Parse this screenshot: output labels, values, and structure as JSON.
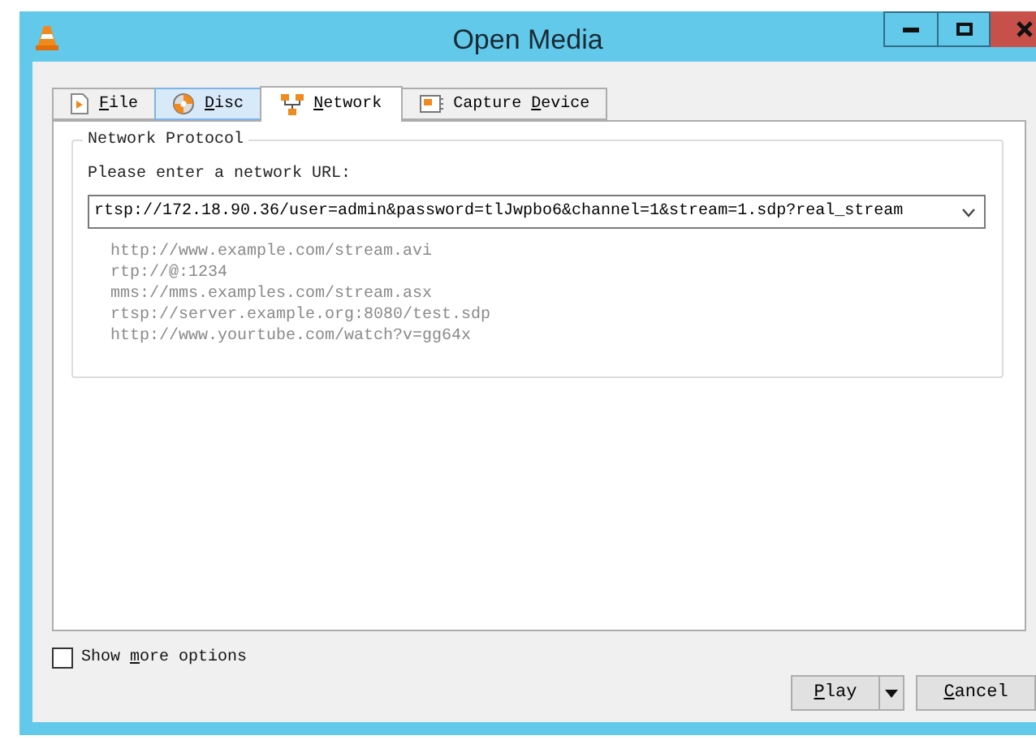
{
  "window": {
    "title": "Open Media"
  },
  "tabs": [
    {
      "kind": "file",
      "mnemonic": "F",
      "after": "ile",
      "selected": false,
      "hovered": false
    },
    {
      "kind": "disc",
      "mnemonic": "D",
      "after": "isc",
      "selected": false,
      "hovered": true
    },
    {
      "kind": "network",
      "mnemonic": "N",
      "after": "etwork",
      "selected": true,
      "hovered": false
    },
    {
      "kind": "capture",
      "before": "Capture ",
      "mnemonic": "D",
      "after": "evice",
      "selected": false,
      "hovered": false
    }
  ],
  "network_protocol": {
    "title": "Network Protocol",
    "prompt": "Please enter a network URL:",
    "url": "rtsp://172.18.90.36/user=admin&password=tlJwpbo6&channel=1&stream=1.sdp?real_stream",
    "examples": [
      "http://www.example.com/stream.avi",
      "rtp://@:1234",
      "mms://mms.examples.com/stream.asx",
      "rtsp://server.example.org:8080/test.sdp",
      "http://www.yourtube.com/watch?v=gg64x"
    ]
  },
  "show_more_options": {
    "before": "Show ",
    "mnemonic": "m",
    "after": "ore options",
    "checked": false
  },
  "buttons": {
    "play": {
      "mnemonic": "P",
      "after": "lay"
    },
    "cancel": {
      "mnemonic": "C",
      "after": "ancel"
    }
  }
}
